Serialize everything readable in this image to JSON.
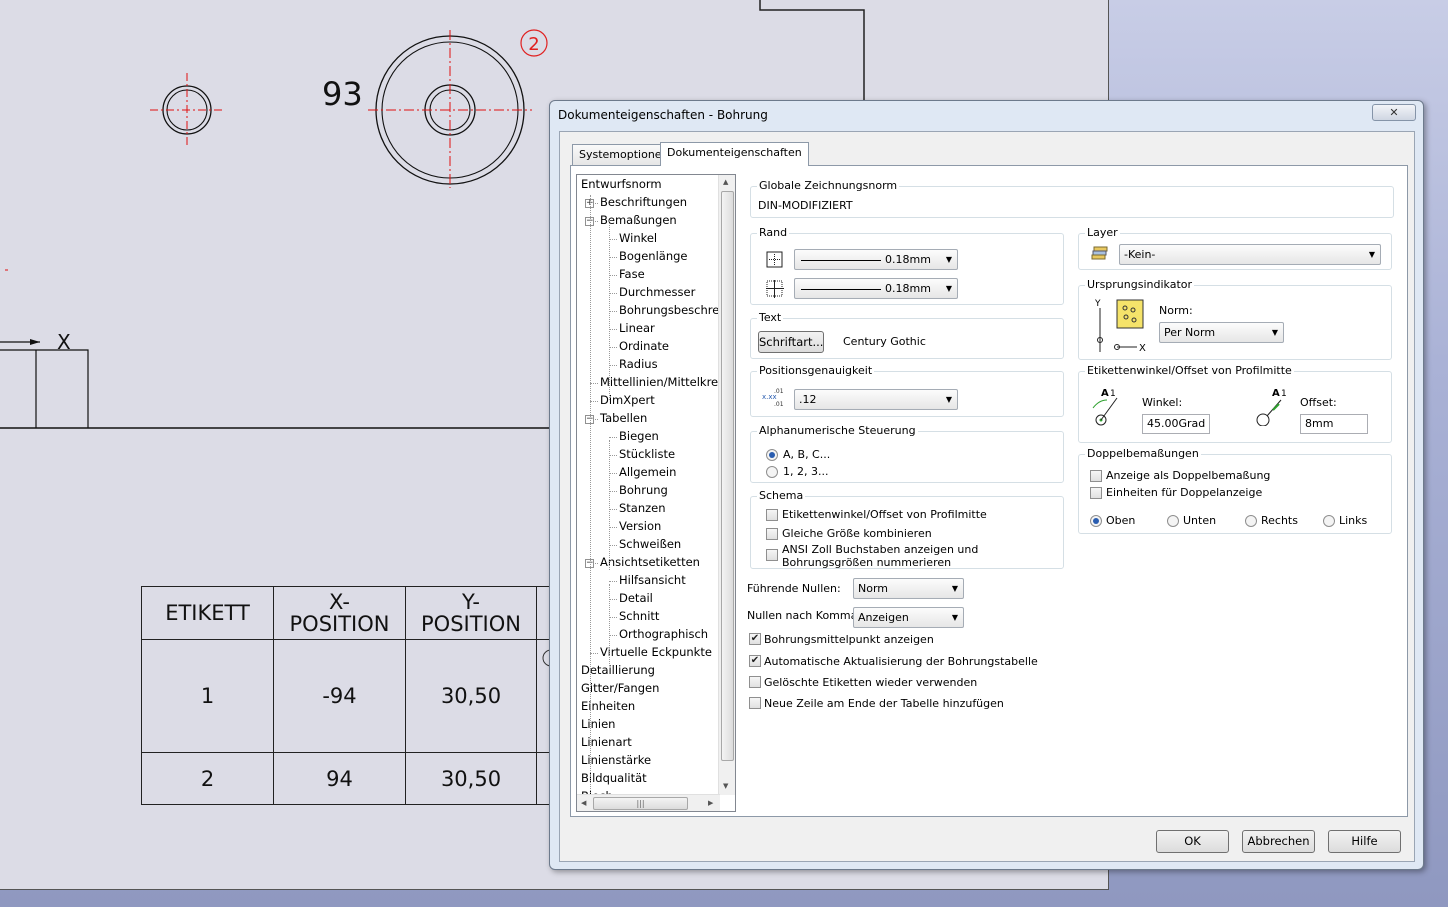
{
  "drawing": {
    "balloon_number": "2",
    "hole_label": "93",
    "column_label": "X",
    "table": {
      "headers": [
        "ETIKETT",
        "X-\nPOSITION",
        "Y-\nPOSITION"
      ],
      "rows": [
        [
          "1",
          "-94",
          "30,50"
        ],
        [
          "2",
          "94",
          "30,50"
        ]
      ]
    }
  },
  "dialog": {
    "title": "Dokumenteigenschaften - Bohrung",
    "close_glyph": "✕",
    "tabs": [
      "Systemoptionen",
      "Dokumenteigenschaften"
    ],
    "tree": [
      "Entwurfsnorm",
      "Beschriftungen",
      "Bemaßungen",
      "Winkel",
      "Bogenlänge",
      "Fase",
      "Durchmesser",
      "Bohrungsbeschreib",
      "Linear",
      "Ordinate",
      "Radius",
      "Mittellinien/Mittelkreu",
      "DimXpert",
      "Tabellen",
      "Biegen",
      "Stückliste",
      "Allgemein",
      "Bohrung",
      "Stanzen",
      "Version",
      "Schweißen",
      "Ansichtsetiketten",
      "Hilfsansicht",
      "Detail",
      "Schnitt",
      "Orthographisch",
      "Virtuelle Eckpunkte",
      "Detaillierung",
      "Gitter/Fangen",
      "Einheiten",
      "Linien",
      "Linienart",
      "Linienstärke",
      "Bildqualität",
      "Blech"
    ],
    "global_norm": {
      "label": "Globale Zeichnungsnorm",
      "value": "DIN-MODIFIZIERT"
    },
    "rand": {
      "label": "Rand",
      "outer": "0.18mm",
      "inner": "0.18mm"
    },
    "text": {
      "label": "Text",
      "font_button": "Schriftart...",
      "font_name": "Century Gothic"
    },
    "precision": {
      "label": "Positionsgenauigkeit",
      "value": ".12"
    },
    "alpha": {
      "label": "Alphanumerische Steuerung",
      "opt1": "A, B, C...",
      "opt2": "1, 2, 3..."
    },
    "schema": {
      "label": "Schema",
      "opt1": "Etikettenwinkel/Offset von Profilmitte",
      "opt2": "Gleiche Größe kombinieren",
      "opt3a": "ANSI Zoll Buchstaben anzeigen und",
      "opt3b": "Bohrungsgrößen nummerieren"
    },
    "leading_zeros": {
      "label": "Führende Nullen:",
      "value": "Norm"
    },
    "trailing_zeros": {
      "label": "Nullen nach Komma:",
      "value": "Anzeigen"
    },
    "checks": [
      "Bohrungsmittelpunkt anzeigen",
      "Automatische Aktualisierung der Bohrungstabelle",
      "Gelöschte Etiketten wieder verwenden",
      "Neue Zeile am Ende der Tabelle hinzufügen"
    ],
    "layer": {
      "label": "Layer",
      "value": "-Kein-"
    },
    "origin": {
      "label": "Ursprungsindikator",
      "norm_label": "Norm:",
      "norm_value": "Per Norm"
    },
    "angle_offset": {
      "label": "Etikettenwinkel/Offset von Profilmitte",
      "angle_label": "Winkel:",
      "angle_value": "45.00Grad",
      "offset_label": "Offset:",
      "offset_value": "8mm"
    },
    "dual": {
      "label": "Doppelbemaßungen",
      "opt1": "Anzeige als Doppelbemaßung",
      "opt2": "Einheiten für Doppelanzeige",
      "pos": [
        "Oben",
        "Unten",
        "Rechts",
        "Links"
      ]
    },
    "buttons": {
      "ok": "OK",
      "cancel": "Abbrechen",
      "help": "Hilfe"
    }
  },
  "colors": {
    "accent": "#2a5db0",
    "balloon": "#e02020",
    "sheet": "#dcdce6"
  }
}
